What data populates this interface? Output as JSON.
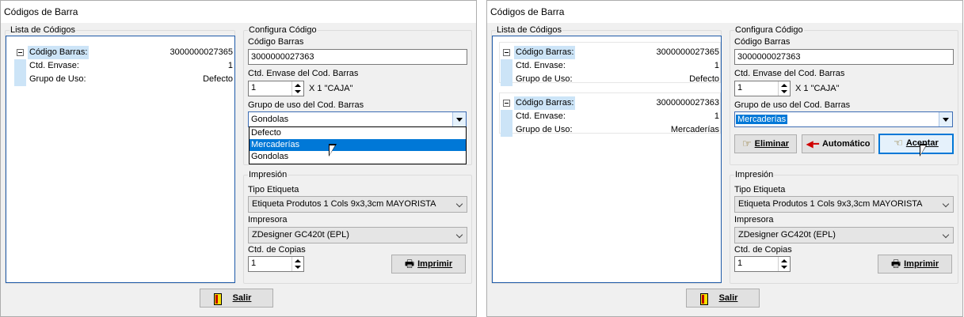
{
  "window_title": "Códigos de Barra",
  "list_group_title": "Lista de Códigos",
  "config_group_title": "Configura Código",
  "print_group_title": "Impresión",
  "code_label": "Código Barras",
  "qty_label": "Ctd. Envase del Cod. Barras",
  "group_label": "Grupo de uso del Cod. Barras",
  "label_type_label": "Tipo Etiqueta",
  "printer_label": "Impresora",
  "copies_label": "Ctd. de Copias",
  "node_fields": {
    "code": "Código Barras:",
    "qty": "Ctd. Envase:",
    "group": "Grupo de Uso:"
  },
  "left": {
    "nodes": [
      {
        "code": "3000000027365",
        "qty": "1",
        "group": "Defecto"
      }
    ],
    "code_value": "3000000027363",
    "qty_value": "1",
    "qty_unit": "X 1 \"CAJA\"",
    "group_value": "Gondolas",
    "dropdown_options": [
      "Defecto",
      "Mercaderías",
      "Gondolas"
    ],
    "highlighted_option": "Mercaderías",
    "label_type_value": "Etiqueta Produtos 1 Cols 9x3,3cm MAYORISTA",
    "printer_value": "ZDesigner GC420t (EPL)",
    "copies_value": "1",
    "print_button": "Imprimir",
    "exit_button": "Salir"
  },
  "right": {
    "nodes": [
      {
        "code": "3000000027365",
        "qty": "1",
        "group": "Defecto"
      },
      {
        "code": "3000000027363",
        "qty": "1",
        "group": "Mercaderías"
      }
    ],
    "code_value": "3000000027363",
    "qty_value": "1",
    "qty_unit": "X 1 \"CAJA\"",
    "group_value": "Mercaderías",
    "delete_button": "Eliminar",
    "auto_button": "Automático",
    "accept_button": "Aceptar",
    "label_type_value": "Etiqueta Produtos 1 Cols 9x3,3cm MAYORISTA",
    "printer_value": "ZDesigner GC420t (EPL)",
    "copies_value": "1",
    "print_button": "Imprimir",
    "exit_button": "Salir"
  },
  "icons": {
    "exit": "door-icon",
    "print": "printer-icon",
    "delete": "pointing-hand-icon",
    "auto": "red-arrow-icon",
    "accept": "pointing-hand-icon",
    "cursor": "mouse-pointer-icon"
  }
}
